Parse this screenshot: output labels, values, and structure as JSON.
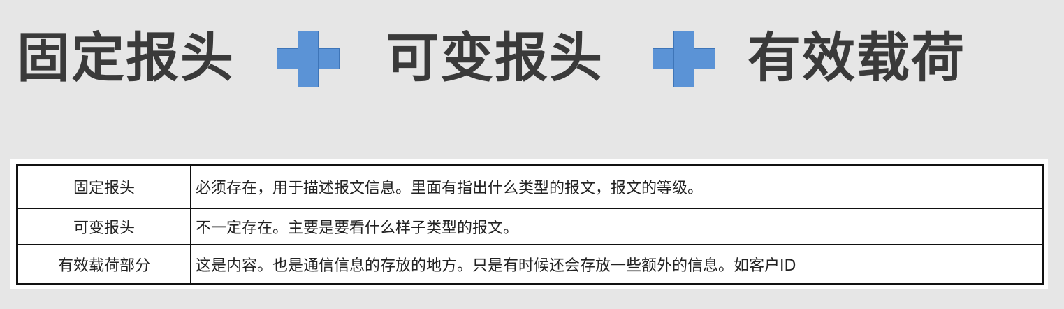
{
  "formula": {
    "term1": "固定报头",
    "term2": "可变报头",
    "term3": "有效载荷",
    "operator_icon": "plus-icon",
    "operator_color": "#5b93d6"
  },
  "table": {
    "rows": [
      {
        "name": "固定报头",
        "description": "必须存在，用于描述报文信息。里面有指出什么类型的报文，报文的等级。"
      },
      {
        "name": "可变报头",
        "description": "不一定存在。主要是要看什么样子类型的报文。"
      },
      {
        "name": "有效载荷部分",
        "description": "这是内容。也是通信信息的存放的地方。只是有时候还会存放一些额外的信息。如客户ID"
      }
    ]
  }
}
